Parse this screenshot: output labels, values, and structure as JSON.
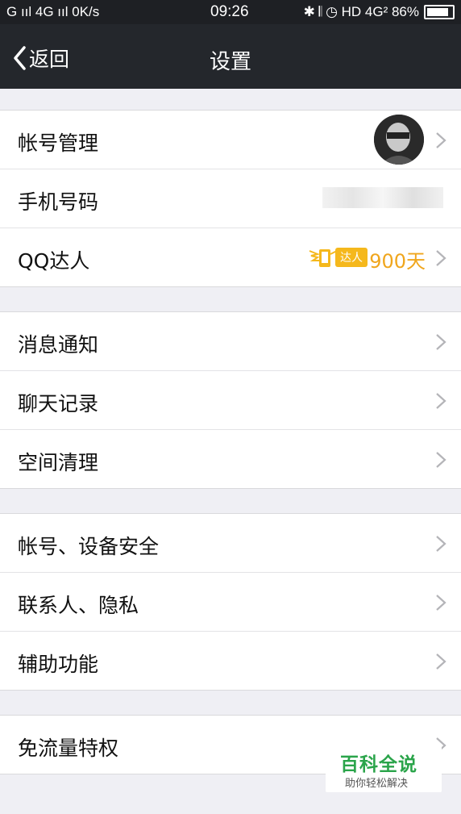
{
  "status_bar": {
    "left": "G ııl 4G ııl 0K/s",
    "time": "09:26",
    "right": "✱ 𝄃 ◷ HD 4G² 86%"
  },
  "header": {
    "back_label": "返回",
    "title": "设置"
  },
  "groups": {
    "account": {
      "account_manage": "帐号管理",
      "phone": "手机号码",
      "qq_talent": "QQ达人",
      "talent_tag": "达人",
      "talent_days": "900天"
    },
    "messages": {
      "notify": "消息通知",
      "chat_history": "聊天记录",
      "space_clean": "空间清理"
    },
    "security": {
      "device_security": "帐号、设备安全",
      "contacts_privacy": "联系人、隐私",
      "assist": "辅助功能"
    },
    "extra": {
      "free_data": "免流量特权"
    }
  },
  "watermark": {
    "title": "百科全说",
    "subtitle": "助你轻松解决"
  },
  "colors": {
    "header_bg": "#24272c",
    "accent_gold": "#f0a61d",
    "watermark_green": "#2aa44a"
  }
}
